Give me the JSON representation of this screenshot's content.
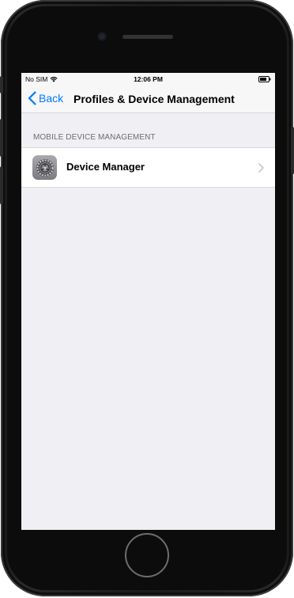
{
  "status_bar": {
    "carrier": "No SIM",
    "time": "12:06 PM",
    "icons": [
      "wifi-icon",
      "battery-icon"
    ]
  },
  "nav": {
    "back_label": "Back",
    "title": "Profiles & Device Management"
  },
  "section": {
    "header": "MOBILE DEVICE MANAGEMENT",
    "items": [
      {
        "label": "Device Manager",
        "icon": "settings-gear-icon"
      }
    ]
  },
  "colors": {
    "accent": "#007aff",
    "background": "#efeff4",
    "section_header": "#6d6d72"
  }
}
